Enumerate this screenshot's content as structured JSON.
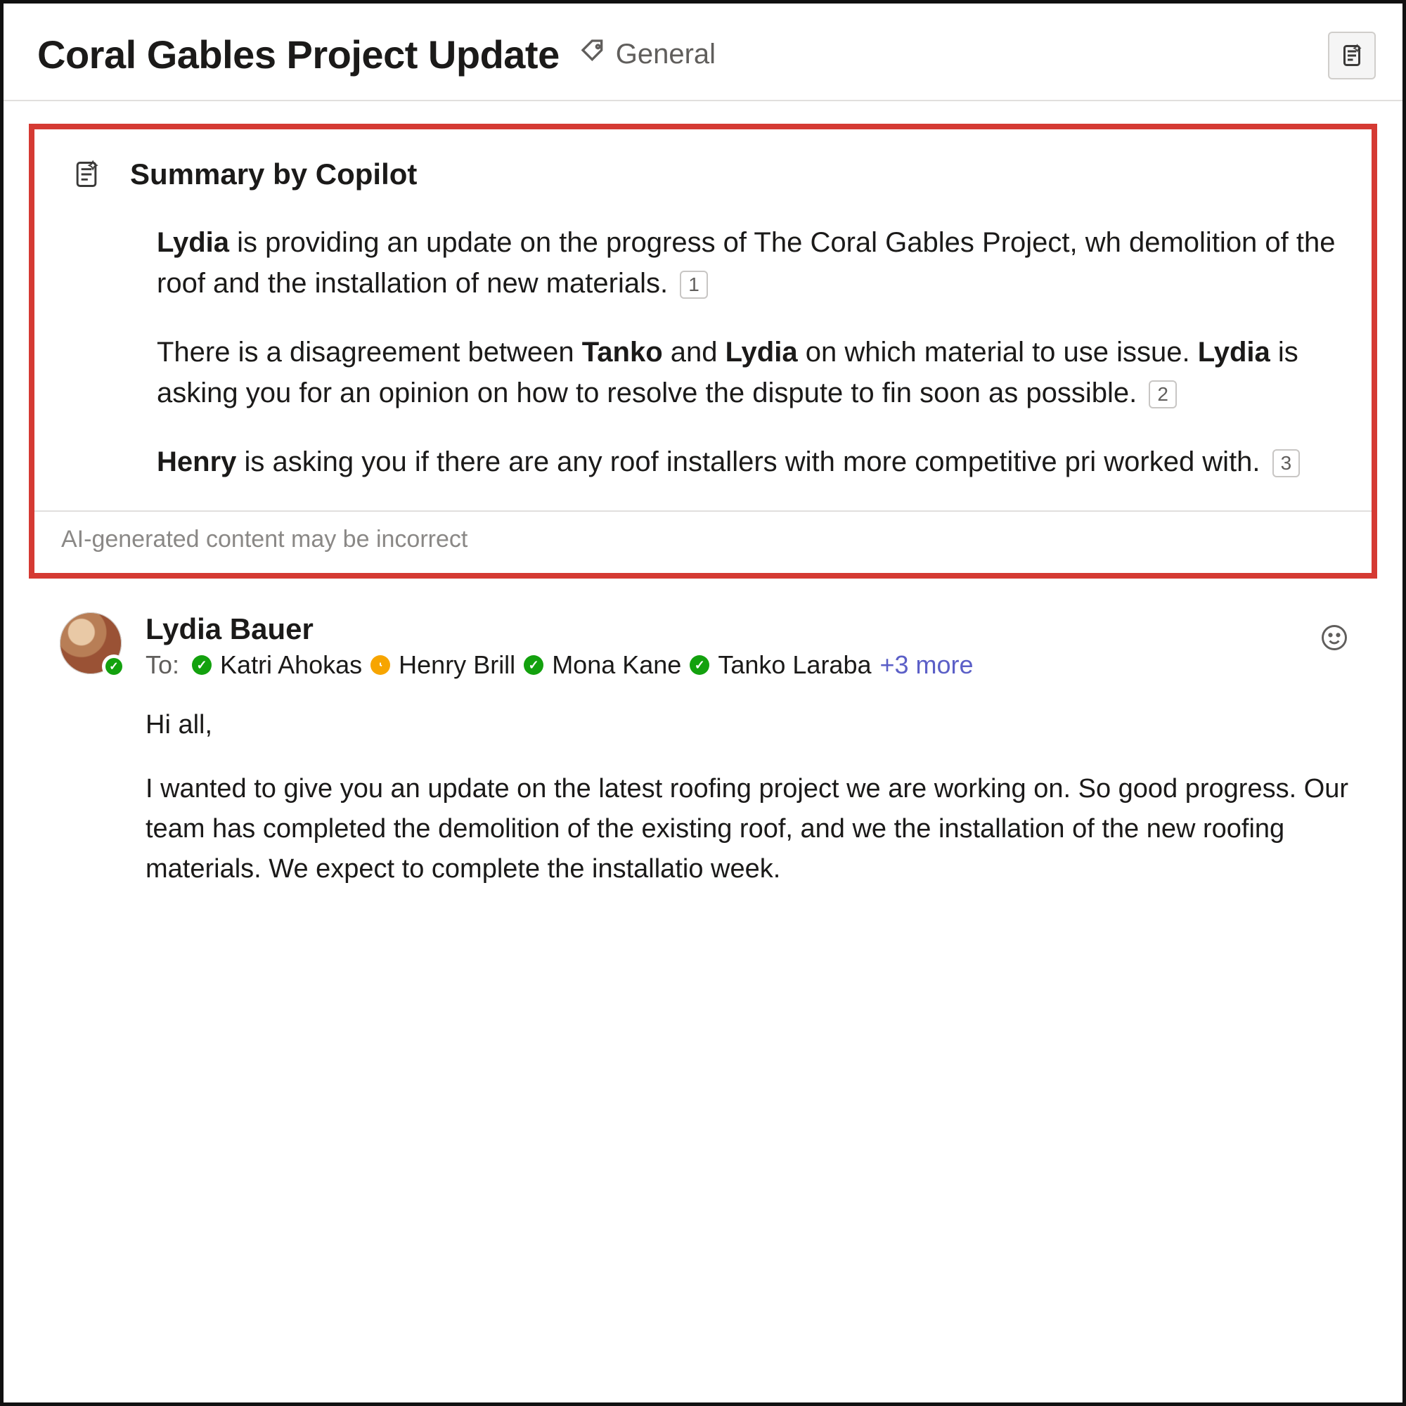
{
  "header": {
    "title": "Coral Gables Project Update",
    "tag": "General"
  },
  "summary": {
    "title": "Summary by Copilot",
    "p1_prefix_bold": "Lydia",
    "p1_rest": " is providing an update on the progress of The Coral Gables Project, wh demolition of the roof and the installation of new materials.",
    "c1": "1",
    "p2_a": "There is a disagreement between ",
    "p2_b_bold": "Tanko",
    "p2_c": " and ",
    "p2_d_bold": "Lydia",
    "p2_e": " on which material to use issue. ",
    "p2_f_bold": "Lydia",
    "p2_g": " is asking you for an opinion on how to resolve the dispute to fin soon as possible.",
    "c2": "2",
    "p3_a_bold": "Henry",
    "p3_b": " is asking you if there are any roof installers with more competitive pri worked with.",
    "c3": "3",
    "disclaimer": "AI-generated content may be incorrect"
  },
  "message": {
    "sender": "Lydia Bauer",
    "to_label": "To:",
    "recipients": [
      {
        "name": "Katri Ahokas",
        "presence": "available"
      },
      {
        "name": "Henry Brill",
        "presence": "away"
      },
      {
        "name": "Mona Kane",
        "presence": "available"
      },
      {
        "name": "Tanko Laraba",
        "presence": "available"
      }
    ],
    "more": "+3 more",
    "body_greeting": "Hi all,",
    "body_p1": "I wanted to give you an update on the latest roofing project we are working on. So good progress. Our team has completed the demolition of the existing roof, and we the installation of the new roofing materials. We expect to complete the installatio week."
  }
}
